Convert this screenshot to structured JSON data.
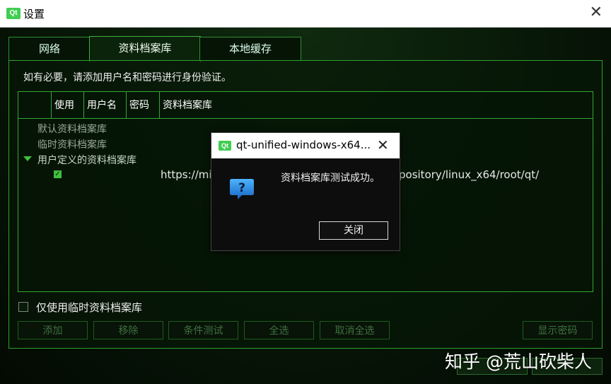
{
  "window": {
    "logo_text": "Qt",
    "title": "设置",
    "close_glyph": "✕"
  },
  "tabs": [
    {
      "label": "网络",
      "active": false
    },
    {
      "label": "资料档案库",
      "active": true
    },
    {
      "label": "本地缓存",
      "active": false
    }
  ],
  "panel": {
    "hint": "如有必要，请添加用户名和密码进行身份验证。",
    "columns": [
      "使用",
      "用户名",
      "密码",
      "资料档案库"
    ],
    "categories": [
      "默认资料档案库",
      "临时资料档案库",
      "用户定义的资料档案库"
    ],
    "user_repo": {
      "checked": true,
      "url_left": "https://mi",
      "url_right": "pository/linux_x64/root/qt/"
    },
    "only_temp_label": "仅使用临时资料档案库",
    "buttons": [
      "添加",
      "移除",
      "条件测试",
      "全选",
      "取消全选",
      "显示密码"
    ]
  },
  "dialog": {
    "logo_text": "Qt",
    "title": "qt-unified-windows-x64...",
    "close_glyph": "✕",
    "message": "资料档案库测试成功。",
    "ok_label": "关闭",
    "icon": "question-icon"
  },
  "watermark": "知乎 @荒山砍柴人",
  "colors": {
    "accent_green": "#3fbf3f",
    "qt_green": "#41cd52",
    "icon_blue": "#1e88e5"
  }
}
